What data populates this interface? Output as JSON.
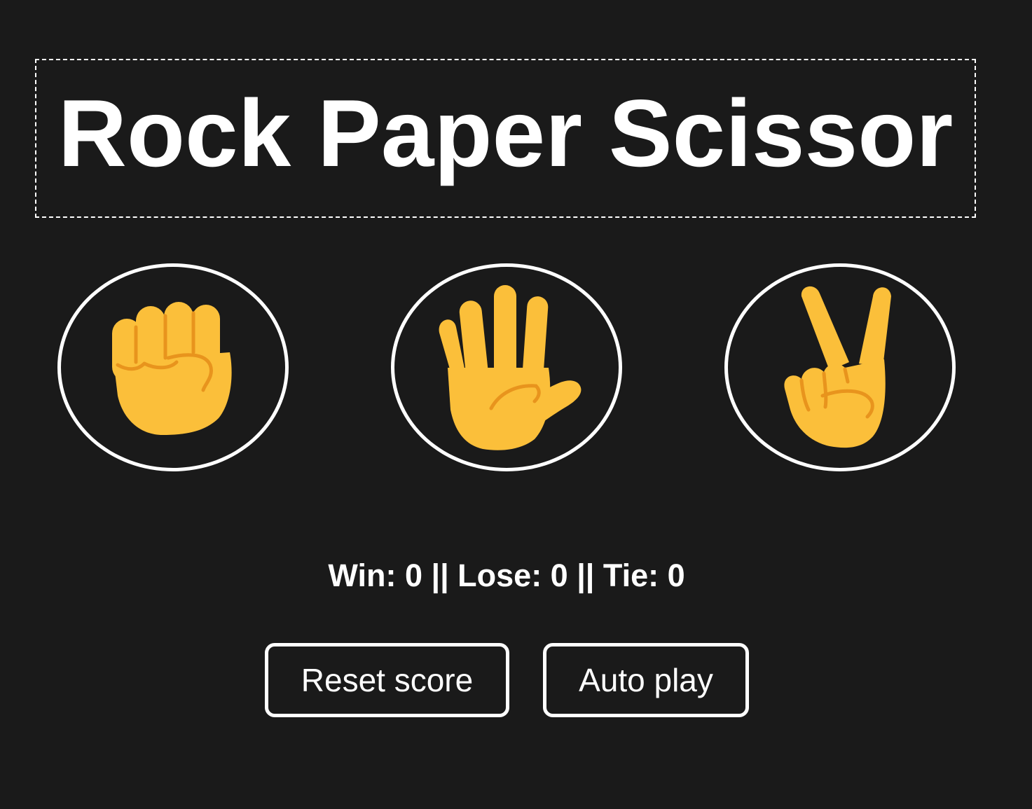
{
  "title": "Rock Paper Scissor",
  "moves": [
    {
      "name": "rock",
      "icon": "raised-fist-icon"
    },
    {
      "name": "paper",
      "icon": "raised-hand-icon"
    },
    {
      "name": "scissors",
      "icon": "victory-hand-icon"
    }
  ],
  "score": {
    "text": "Win: 0 || Lose: 0 || Tie: 0",
    "wins": 0,
    "losses": 0,
    "ties": 0
  },
  "buttons": {
    "reset_label": "Reset score",
    "autoplay_label": "Auto play"
  },
  "colors": {
    "background": "#1a1a1a",
    "foreground": "#ffffff",
    "emoji_skin": "#fbbf3a",
    "emoji_line": "#e8941d"
  }
}
